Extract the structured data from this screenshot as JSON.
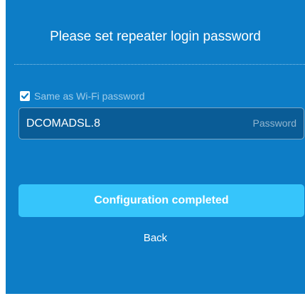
{
  "dialog": {
    "title": "Please set repeater login password",
    "same_as_wifi": {
      "label": "Same as Wi-Fi password",
      "checked": true
    },
    "password_field": {
      "value": "DCOMADSL.8",
      "hint": "Password"
    },
    "complete_button_label": "Configuration completed",
    "back_label": "Back"
  },
  "colors": {
    "panel_background": "#0d7dc6",
    "input_background": "#0a5c96",
    "primary_button": "#36c5fb",
    "text": "#ffffff"
  },
  "icons": {
    "checkbox": "checkmark-icon"
  }
}
